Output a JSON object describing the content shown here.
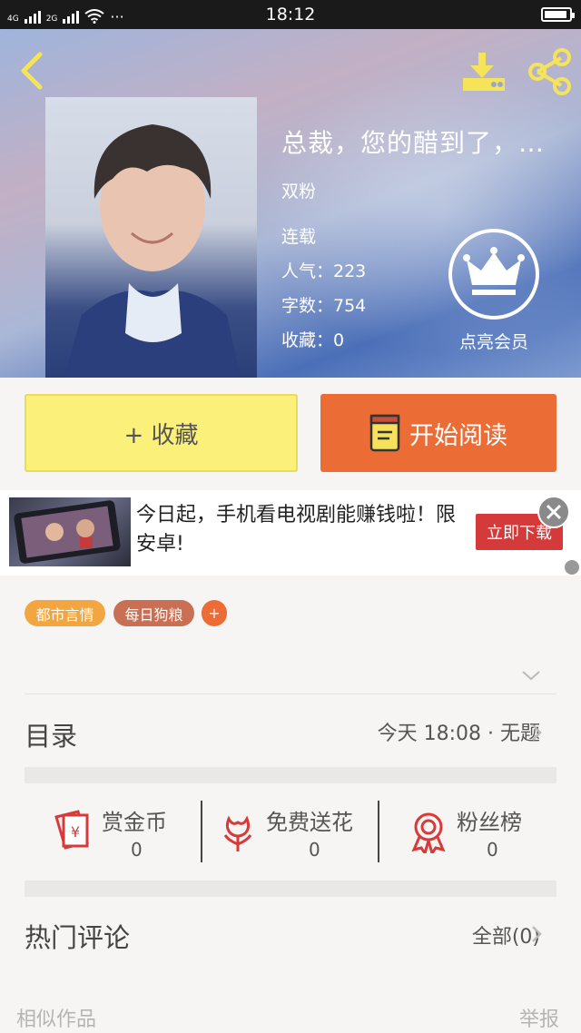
{
  "status_bar": {
    "time": "18:12",
    "network_1": "4G",
    "network_2": "2G",
    "dots": "···"
  },
  "book": {
    "title": "总裁，您的醋到了，…",
    "author": "双粉",
    "status": "连载",
    "popularity_label": "人气：223",
    "word_count_label": "字数：754",
    "favorites_label": "收藏：0"
  },
  "vip": {
    "label": "点亮会员"
  },
  "actions": {
    "collect_label": "+ 收藏",
    "read_label": "开始阅读"
  },
  "ad": {
    "text": "今日起，手机看电视剧能赚钱啦！限安卓!",
    "button_label": "立即下载"
  },
  "tags": [
    {
      "label": "都市言情",
      "color": "#f2a640"
    },
    {
      "label": "每日狗粮",
      "color": "#c86f54"
    },
    {
      "label": "+",
      "color": "#ec6c36"
    }
  ],
  "catalog": {
    "title": "目录",
    "latest": "今天 18:08 · 无题"
  },
  "stats": [
    {
      "label": "赏金币",
      "value": "0",
      "icon": "red-envelope-icon"
    },
    {
      "label": "免费送花",
      "value": "0",
      "icon": "flower-icon"
    },
    {
      "label": "粉丝榜",
      "value": "0",
      "icon": "medal-icon"
    }
  ],
  "comments": {
    "title": "热门评论",
    "all_label": "全部(0)"
  },
  "footer": {
    "similar_label": "相似作品",
    "report_label": "举报"
  },
  "colors": {
    "accent_orange": "#ec6c36",
    "collect_yellow": "#fbf07a",
    "icon_red": "#d83a3a",
    "header_icon_yellow": "#f5e35a"
  }
}
